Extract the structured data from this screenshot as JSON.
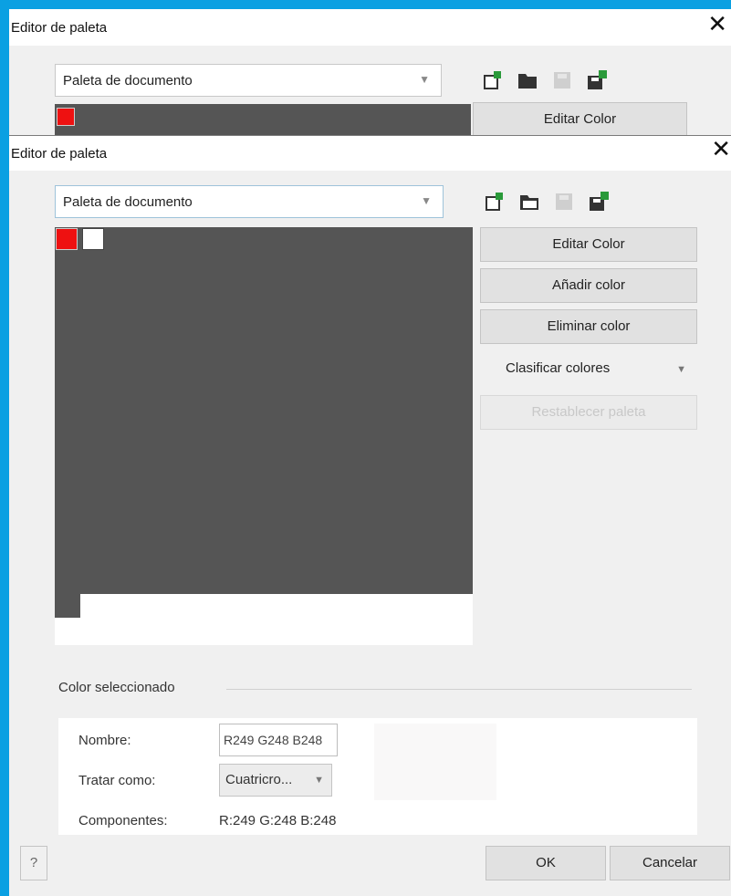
{
  "back_dialog": {
    "title": "Editor de paleta",
    "palette_select": "Paleta de documento",
    "edit_button": "Editar Color"
  },
  "dialog": {
    "title": "Editor de paleta",
    "palette_select": "Paleta de documento",
    "toolbar_icons": [
      "new-palette-icon",
      "open-palette-icon",
      "save-palette-icon",
      "save-as-palette-icon"
    ],
    "swatches": [
      {
        "name": "red",
        "color": "#ee1111"
      },
      {
        "name": "white",
        "color": "#ffffff"
      }
    ],
    "buttons": {
      "edit": "Editar Color",
      "add": "Añadir color",
      "delete": "Eliminar color",
      "sort": "Clasificar colores",
      "reset": "Restablecer paleta"
    },
    "selected": {
      "group_label": "Color seleccionado",
      "name_label": "Nombre:",
      "name_value": "R249 G248 B248",
      "treat_label": "Tratar como:",
      "treat_value": "Cuatricro...",
      "components_label": "Componentes:",
      "components_value": "R:249 G:248 B:248",
      "preview_color": "#f9f8f8"
    },
    "footer": {
      "help": "?",
      "ok": "OK",
      "cancel": "Cancelar"
    }
  }
}
